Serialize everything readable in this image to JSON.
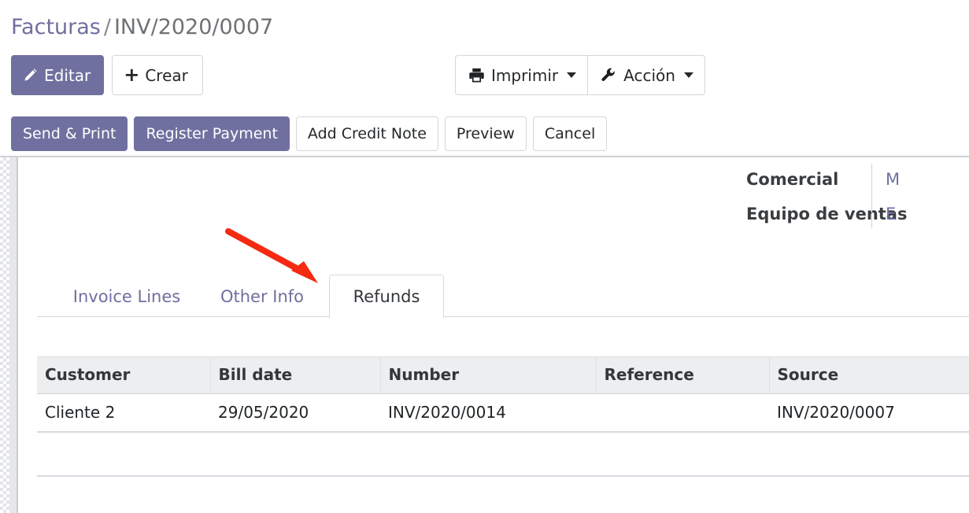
{
  "breadcrumb": {
    "root": "Facturas",
    "separator": "/",
    "current": "INV/2020/0007"
  },
  "toolbar": {
    "edit_label": "Editar",
    "create_label": "Crear",
    "create_plus": "+",
    "print_label": "Imprimir",
    "action_label": "Acción",
    "print_icon": "printer-icon",
    "action_icon": "wrench-icon",
    "edit_icon": "pencil-icon"
  },
  "status_buttons": [
    {
      "label": "Send & Print",
      "style": "primary"
    },
    {
      "label": "Register Payment",
      "style": "primary"
    },
    {
      "label": "Add Credit Note",
      "style": "default"
    },
    {
      "label": "Preview",
      "style": "default"
    },
    {
      "label": "Cancel",
      "style": "default"
    }
  ],
  "info": {
    "labels": [
      "Comercial",
      "Equipo de ventas"
    ],
    "values": [
      "M",
      "E"
    ]
  },
  "tabs": [
    {
      "label": "Invoice Lines",
      "active": false
    },
    {
      "label": "Other Info",
      "active": false
    },
    {
      "label": "Refunds",
      "active": true
    }
  ],
  "refunds_table": {
    "columns": [
      "Customer",
      "Bill date",
      "Number",
      "Reference",
      "Source"
    ],
    "rows": [
      {
        "customer": "Cliente 2",
        "bill_date": "29/05/2020",
        "number": "INV/2020/0014",
        "reference": "",
        "source": "INV/2020/0007"
      }
    ]
  },
  "annotation": {
    "type": "arrow",
    "color": "#f42a12",
    "points_to": "Refunds"
  },
  "colors": {
    "accent_purple": "#7070a0",
    "link_purple": "#6f6fa0",
    "annotation_red": "#f42a12",
    "table_header_bg": "#eceeef"
  }
}
